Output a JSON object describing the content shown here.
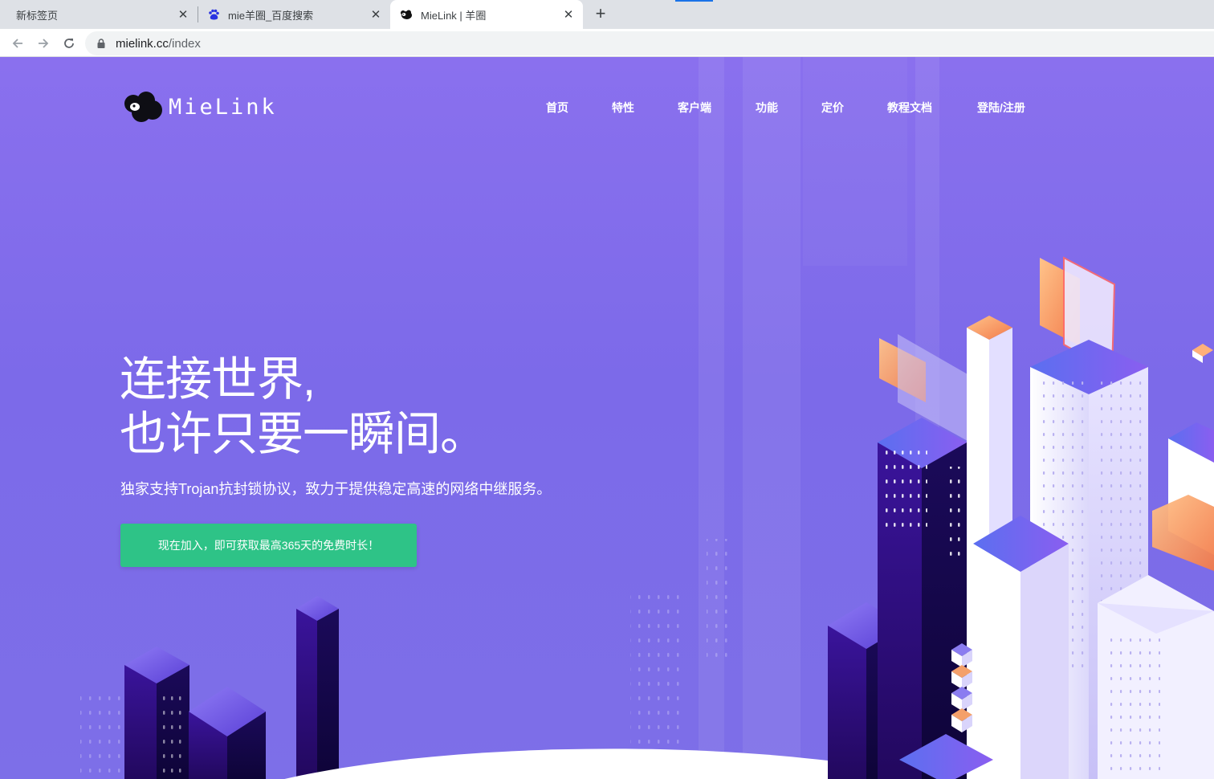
{
  "browser": {
    "tabs": [
      {
        "title": "新标签页",
        "active": false
      },
      {
        "title": "mie羊圈_百度搜索",
        "active": false,
        "favicon": "baidu-paw-icon"
      },
      {
        "title": "MieLink | 羊圈",
        "active": true,
        "favicon": "sheep-icon"
      }
    ],
    "new_tab_symbol": "+",
    "close_symbol": "✕",
    "url_host": "mielink.cc",
    "url_path": "/index"
  },
  "site": {
    "logo_text": "MieLink",
    "nav": [
      "首页",
      "特性",
      "客户端",
      "功能",
      "定价",
      "教程文档",
      "登陆/注册"
    ],
    "hero": {
      "title_line1": "连接世界,",
      "title_line2": "也许只要一瞬间。",
      "subtitle": "独家支持Trojan抗封锁协议，致力于提供稳定高速的网络中继服务。",
      "cta": "现在加入，即可获取最高365天的免费时长！"
    }
  },
  "colors": {
    "hero_bg": "#8370ec",
    "cta_bg": "#2ec387",
    "nav_text": "#ffffff"
  }
}
